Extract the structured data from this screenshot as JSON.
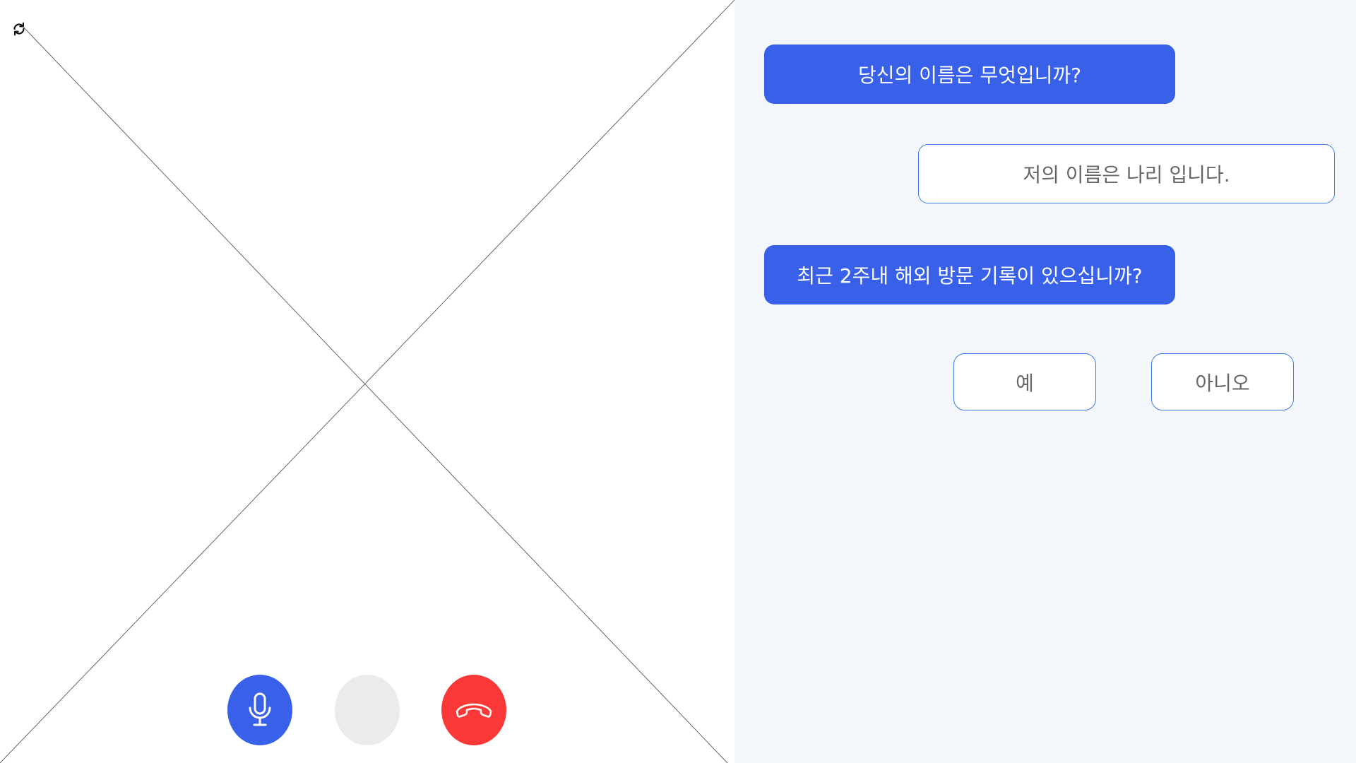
{
  "video": {
    "switch_camera_icon": "switch-camera-icon",
    "controls": {
      "mic": {
        "icon": "microphone-icon",
        "color": "#3860e8"
      },
      "blank": {
        "color": "#ebebeb"
      },
      "hangup": {
        "icon": "phone-hangup-icon",
        "color": "#fb3838"
      }
    }
  },
  "chat": {
    "messages": [
      {
        "from": "bot",
        "text": "당신의 이름은 무엇입니까?"
      },
      {
        "from": "user",
        "text": "저의 이름은 나리 입니다."
      },
      {
        "from": "bot",
        "text": "최근 2주내 해외 방문 기록이 있으십니까?"
      }
    ],
    "choices": [
      {
        "label": "예"
      },
      {
        "label": "아니오"
      }
    ]
  },
  "colors": {
    "accent": "#3860e8",
    "danger": "#fb3838",
    "chat_bg": "#f3f6fb",
    "border": "#3e7be6"
  }
}
